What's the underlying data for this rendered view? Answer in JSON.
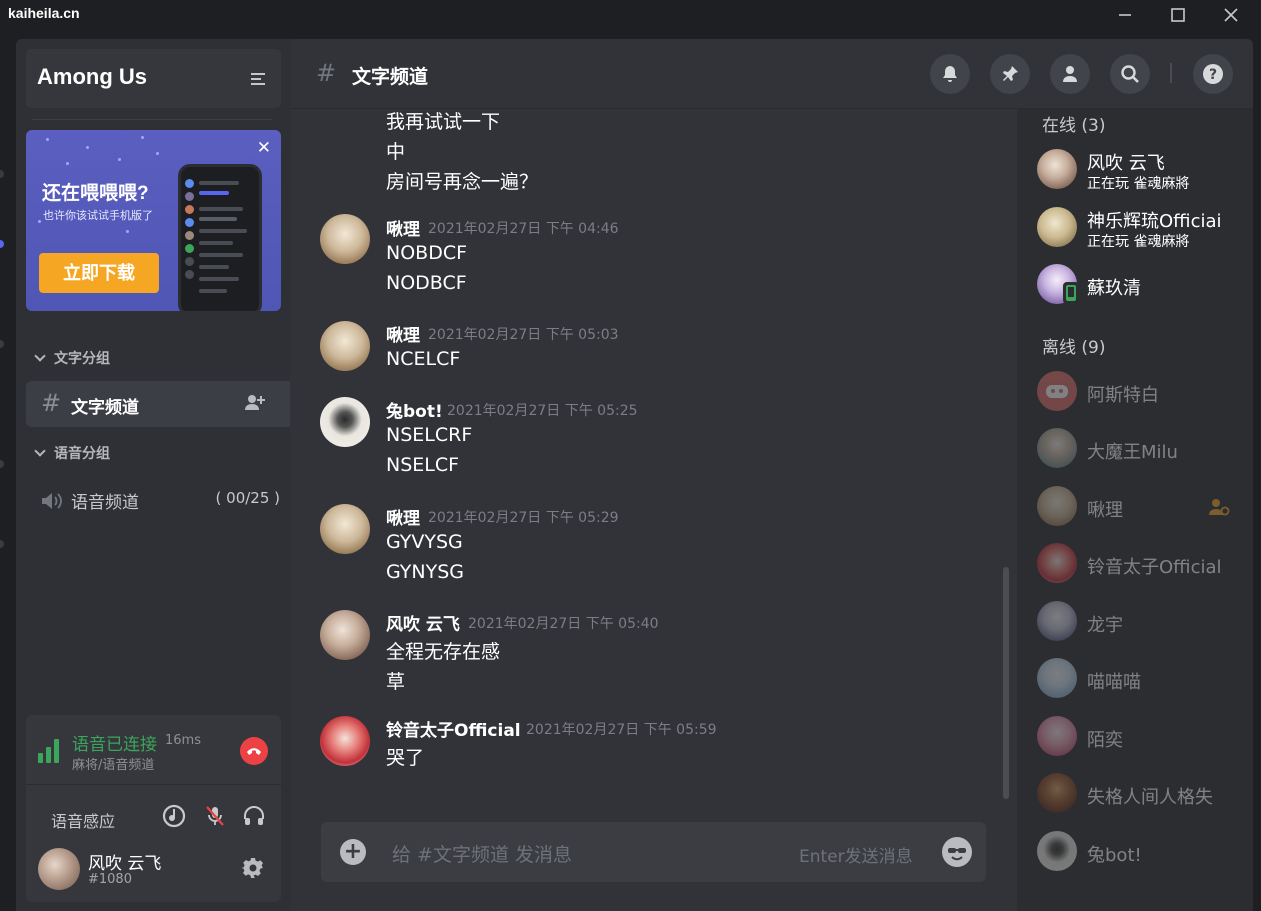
{
  "window": {
    "title": "kaiheila.cn"
  },
  "guild": {
    "name": "Among Us"
  },
  "promo": {
    "title": "还在喂喂喂?",
    "subtitle": "也许你该试试手机版了",
    "button": "立即下载"
  },
  "categories": {
    "text": "文字分组",
    "voice": "语音分组"
  },
  "text_channel": {
    "name": "文字频道"
  },
  "voice_channel": {
    "name": "语音频道",
    "count": "( 00/25 )"
  },
  "voice_status": {
    "status": "语音已连接",
    "latency": "16ms",
    "location": "麻将/语音频道",
    "mode": "语音感应"
  },
  "user": {
    "name": "风吹 云飞",
    "tag": "#1080"
  },
  "header": {
    "channel": "文字频道"
  },
  "messages": [
    {
      "lines": [
        "我再试试一下",
        "中",
        "房间号再念一遍？"
      ]
    },
    {
      "author": "啾理",
      "time": "2021年02月27日 下午 04:46",
      "lines": [
        "NOBDCF",
        "NODBCF"
      ]
    },
    {
      "author": "啾理",
      "time": "2021年02月27日 下午 05:03",
      "lines": [
        "NCELCF"
      ]
    },
    {
      "author": "兔bot!",
      "time": "2021年02月27日 下午 05:25",
      "lines": [
        "NSELCRF",
        "NSELCF"
      ]
    },
    {
      "author": "啾理",
      "time": "2021年02月27日 下午 05:29",
      "lines": [
        "GYVYSG",
        "GYNYSG"
      ]
    },
    {
      "author": "风吹 云飞",
      "time": "2021年02月27日 下午 05:40",
      "lines": [
        "全程无存在感",
        "草"
      ]
    },
    {
      "author": "铃音太子Official",
      "time": "2021年02月27日 下午 05:59",
      "lines": [
        "哭了"
      ]
    }
  ],
  "composer": {
    "placeholder": "给 #文字频道 发消息",
    "hint": "Enter发送消息"
  },
  "members": {
    "online_header": "在线 (3)",
    "offline_header": "离线 (9)",
    "online": [
      {
        "name": "风吹 云飞",
        "activity": "正在玩 雀魂麻將"
      },
      {
        "name": "神乐辉琉Officiai",
        "activity": "正在玩 雀魂麻將"
      },
      {
        "name": "蘇玖清"
      }
    ],
    "offline": [
      {
        "name": "阿斯特白"
      },
      {
        "name": "大魔王Milu"
      },
      {
        "name": "啾理"
      },
      {
        "name": "铃音太子Official"
      },
      {
        "name": "龙宇"
      },
      {
        "name": "喵喵喵"
      },
      {
        "name": "陌奕"
      },
      {
        "name": "失格人间人格失"
      },
      {
        "name": "兔bot!"
      }
    ]
  },
  "colors": {
    "accent_green": "#3ba55c",
    "hangup_red": "#ed4245",
    "promo_bg": "#5b5fc0",
    "promo_button": "#f5a623"
  }
}
